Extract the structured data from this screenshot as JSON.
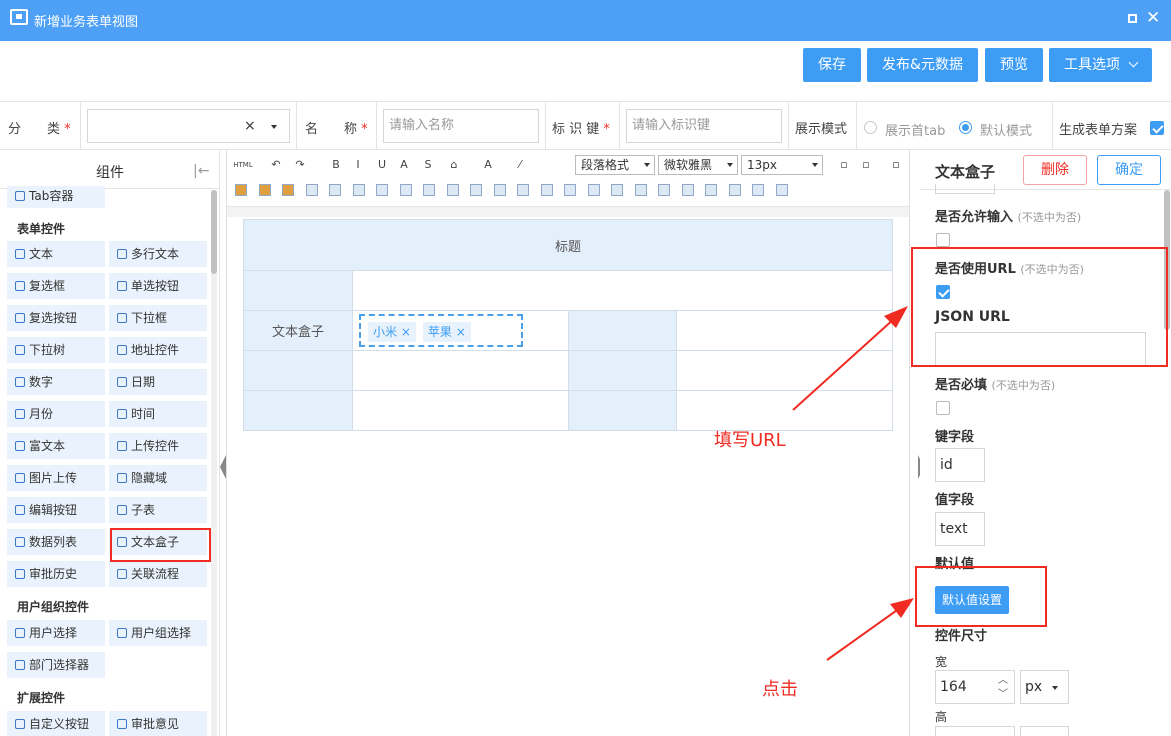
{
  "window": {
    "title": "新增业务表单视图"
  },
  "toolbar": {
    "save": "保存",
    "publish": "发布&元数据",
    "preview": "预览",
    "tools": "工具选项"
  },
  "form": {
    "category_label": "分　　类",
    "name_label": "名　　称",
    "name_placeholder": "请输入名称",
    "key_label": "标 识 键",
    "key_placeholder": "请输入标识键",
    "mode_label": "展示模式",
    "mode_first_tab": "展示首tab",
    "mode_default": "默认模式",
    "gen_label": "生成表单方案",
    "required_mark": "*"
  },
  "left": {
    "title": "组件",
    "tab_container": "Tab容器",
    "sections": [
      "表单控件",
      "用户组织控件",
      "扩展控件"
    ],
    "form_items": [
      "文本",
      "多行文本",
      "复选框",
      "单选按钮",
      "复选按钮",
      "下拉框",
      "下拉树",
      "地址控件",
      "数字",
      "日期",
      "月份",
      "时间",
      "富文本",
      "上传控件",
      "图片上传",
      "隐藏域",
      "编辑按钮",
      "子表",
      "数据列表",
      "文本盒子",
      "审批历史",
      "关联流程"
    ],
    "user_items": [
      "用户选择",
      "用户组选择",
      "部门选择器"
    ],
    "ext_items": [
      "自定义按钮",
      "审批意见"
    ]
  },
  "editor": {
    "para_format": "段落格式",
    "font_name": "微软雅黑",
    "font_size": "13px",
    "html_btn": "HTML",
    "table_title": "标题",
    "field_label": "文本盒子",
    "tags": [
      "小米",
      "苹果"
    ]
  },
  "right": {
    "title": "文本盒子",
    "delete": "删除",
    "confirm": "确定",
    "allow_input": "是否允许输入",
    "hint": "(不选中为否)",
    "use_url": "是否使用URL",
    "json_url": "JSON URL",
    "required": "是否必填",
    "key_field": "键字段",
    "key_value": "id",
    "value_field": "值字段",
    "value_value": "text",
    "default_label": "默认值",
    "default_btn": "默认值设置",
    "size_label": "控件尺寸",
    "width_label": "宽",
    "width_value": "164",
    "width_unit": "px",
    "height_label": "高"
  },
  "annotations": {
    "fill_url": "填写URL",
    "click": "点击"
  },
  "colors": {
    "accent": "#3d9df5",
    "title_bar": "#4da0f5",
    "highlight": "#f02b22",
    "cell_fill": "#e3effb"
  }
}
